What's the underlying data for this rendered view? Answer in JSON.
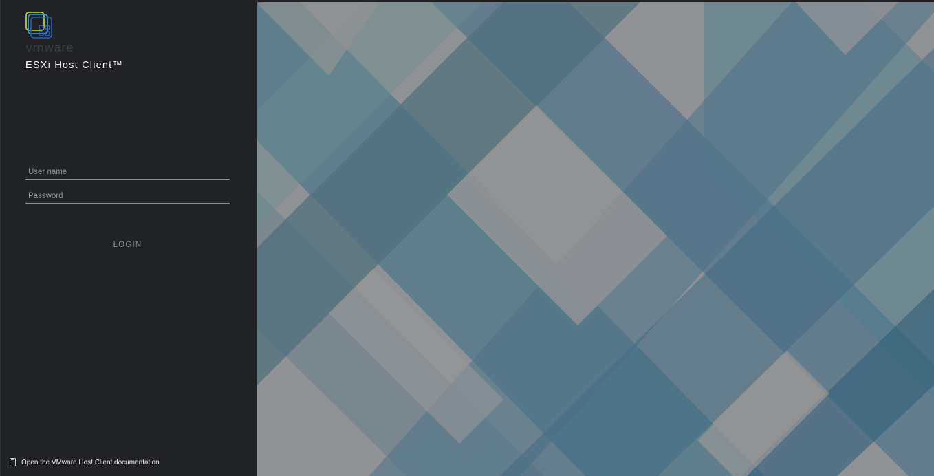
{
  "brand": {
    "wordmark": "vmware",
    "product": "ESXi Host Client™",
    "logo_icon": "vmware-logo-icon"
  },
  "login_form": {
    "username_placeholder": "User name",
    "password_placeholder": "Password",
    "login_label": "LOGIN"
  },
  "footer": {
    "doc_link_label": "Open the VMware Host Client documentation",
    "doc_icon": "document-icon"
  },
  "colors": {
    "panel_bg": "#202225",
    "text_primary": "#f2f2f2",
    "field_underline": "#8c8f93",
    "background_gray": "#8f9194",
    "background_teal": "#5a8590",
    "background_blue": "#4a6f88"
  }
}
